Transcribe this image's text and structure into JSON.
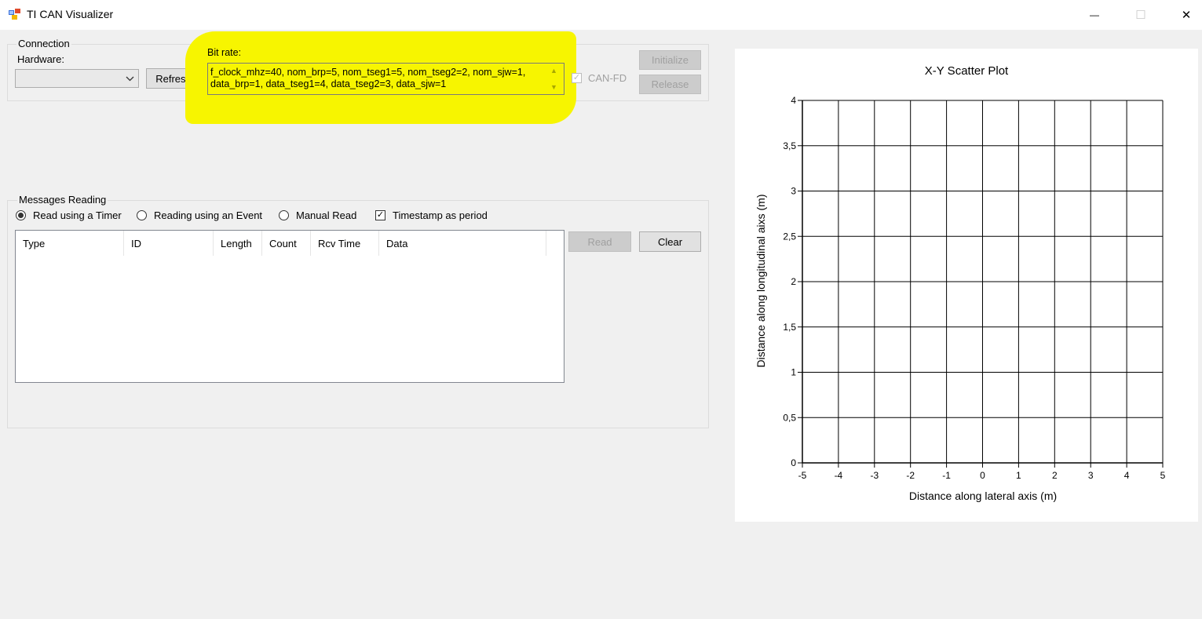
{
  "window": {
    "title": "TI CAN Visualizer",
    "icon": "app-icon",
    "controls": {
      "minimize": "—",
      "maximize": "☐",
      "close": "✕"
    }
  },
  "connection": {
    "group_label": "Connection",
    "hardware_label": "Hardware:",
    "hardware_value": "",
    "refresh_label": "Refresh",
    "bitrate_label": "Bit rate:",
    "bitrate_value": "f_clock_mhz=40, nom_brp=5, nom_tseg1=5, nom_tseg2=2, nom_sjw=1,\ndata_brp=1, data_tseg1=4, data_tseg2=3, data_sjw=1",
    "canfd_label": "CAN-FD",
    "canfd_checked": true,
    "initialize_label": "Initialize",
    "release_label": "Release",
    "highlight_color": "#f7f500"
  },
  "messages": {
    "group_label": "Messages Reading",
    "radio_timer": "Read using a Timer",
    "radio_event": "Reading using an Event",
    "radio_manual": "Manual Read",
    "selected_mode": "timer",
    "timestamp_label": "Timestamp as period",
    "timestamp_checked": true,
    "columns": [
      "Type",
      "ID",
      "Length",
      "Count",
      "Rcv Time",
      "Data"
    ],
    "rows": [],
    "read_label": "Read",
    "clear_label": "Clear"
  },
  "chart_data": {
    "type": "scatter",
    "title": "X-Y Scatter Plot",
    "xlabel": "Distance along lateral axis (m)",
    "ylabel": "Distance along longitudinal aixs (m)",
    "xlim": [
      -5,
      5
    ],
    "ylim": [
      0,
      4
    ],
    "xticks": [
      "-5",
      "-4",
      "-3",
      "-2",
      "-1",
      "0",
      "1",
      "2",
      "3",
      "4",
      "5"
    ],
    "yticks": [
      "0",
      "0,5",
      "1",
      "1,5",
      "2",
      "2,5",
      "3",
      "3,5",
      "4"
    ],
    "grid": true,
    "series": [
      {
        "points": []
      }
    ]
  }
}
